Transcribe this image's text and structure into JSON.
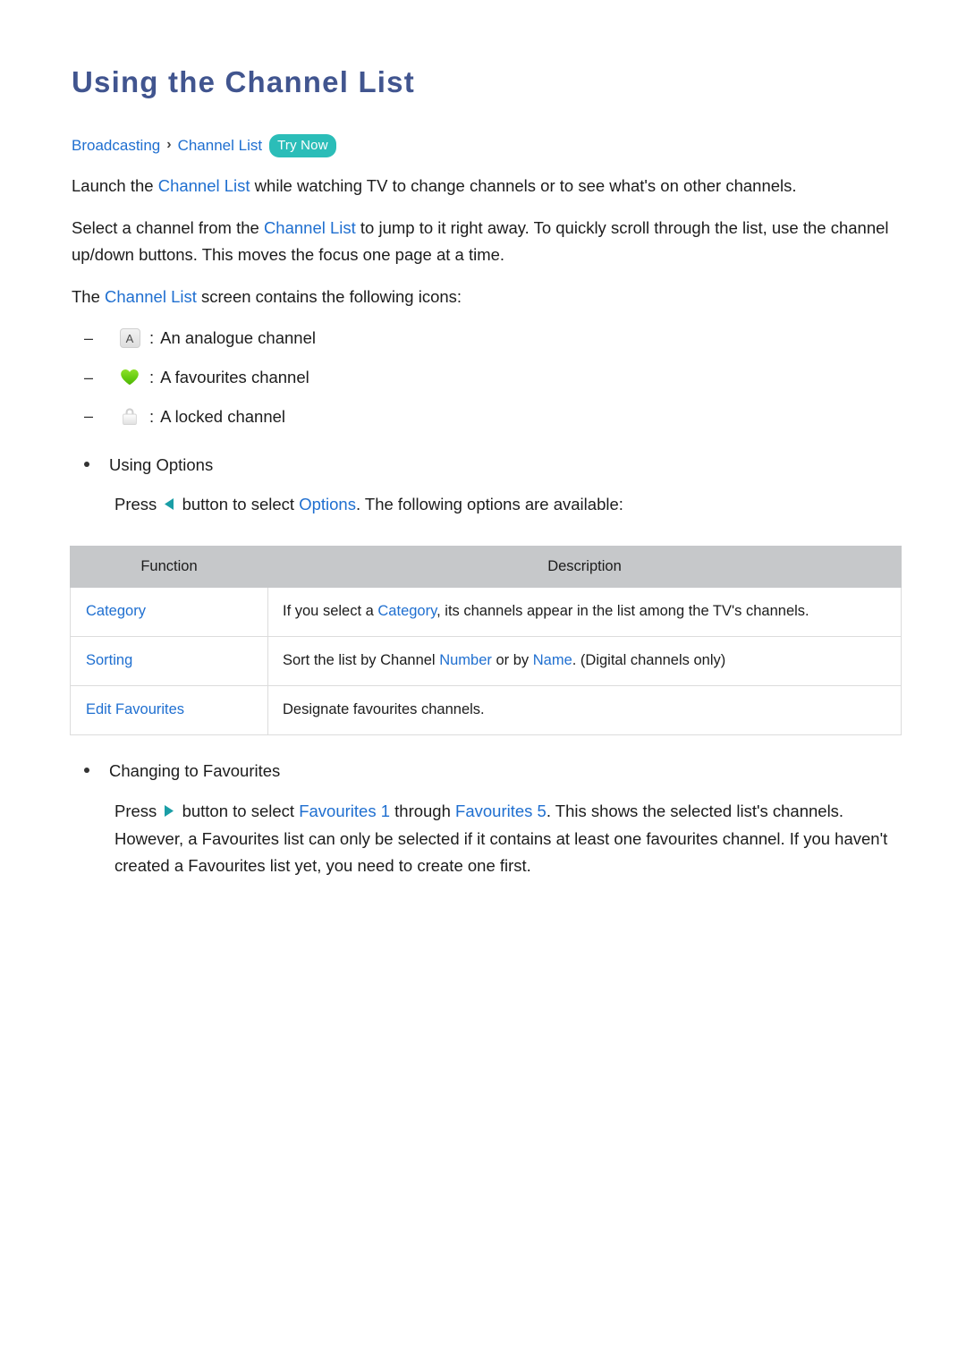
{
  "document": {
    "title": "Using the Channel List",
    "breadcrumb": {
      "items": [
        "Broadcasting",
        "Channel List"
      ],
      "separator": "›",
      "badge": "Try Now"
    },
    "paragraphs": {
      "p1_a": "Launch the ",
      "p1_link": "Channel List",
      "p1_b": " while watching TV to change channels or to see what's on other channels.",
      "p2_a": "Select a channel from the ",
      "p2_link": "Channel List",
      "p2_b": " to jump to it right away. To quickly scroll through the list, use the channel up/down buttons. This moves the focus one page at a time.",
      "p3_a": "The ",
      "p3_link": "Channel List",
      "p3_b": " screen contains the following icons:"
    },
    "icon_legend": [
      {
        "icon": "analogue-channel-icon",
        "glyph": "A",
        "colon": ":",
        "label": "An analogue channel"
      },
      {
        "icon": "favourites-heart-icon",
        "glyph": "♥",
        "colon": ":",
        "label": "A favourites channel"
      },
      {
        "icon": "locked-channel-icon",
        "glyph": "🔒",
        "colon": ":",
        "label": "A locked channel"
      }
    ],
    "sections": [
      {
        "heading": "Using Options",
        "text_a": "Press ",
        "arrow": "left-arrow-icon",
        "text_b": " button to select ",
        "link": "Options",
        "text_c": ". The following options are available:"
      },
      {
        "heading": "Changing to Favourites",
        "text_a": "Press ",
        "arrow": "right-arrow-icon",
        "text_b": " button to select ",
        "link1": "Favourites 1",
        "text_c": " through ",
        "link2": "Favourites 5",
        "text_d": ". This shows the selected list's channels. However, a Favourites list can only be selected if it contains at least one favourites channel. If you haven't created a Favourites list yet, you need to create one first."
      }
    ],
    "options_table": {
      "headers": [
        "Function",
        "Description"
      ],
      "rows": [
        {
          "function": "Category",
          "desc_a": "If you select a ",
          "desc_link": "Category",
          "desc_b": ", its channels appear in the list among the TV's channels."
        },
        {
          "function": "Sorting",
          "desc_a": "Sort the list by Channel ",
          "desc_link": "Number",
          "desc_b": " or by ",
          "desc_link2": "Name",
          "desc_c": ". (Digital channels only)"
        },
        {
          "function": "Edit Favourites",
          "desc_a": "Designate favourites channels.",
          "desc_link": "",
          "desc_b": ""
        }
      ]
    },
    "colors": {
      "title_blue": "#41558f",
      "link_blue": "#1f6fd0",
      "badge_teal": "#2bbdb8",
      "arrow_teal": "#1a9ea6",
      "table_header_gray": "#c6c8ca",
      "heart_green": "#66cc11"
    }
  }
}
